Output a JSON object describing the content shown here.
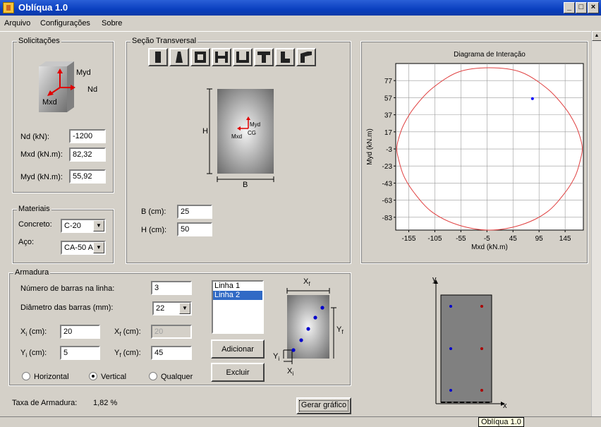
{
  "window": {
    "title": "Oblíqua 1.0"
  },
  "menu": [
    "Arquivo",
    "Configurações",
    "Sobre"
  ],
  "solicitacoes": {
    "title": "Solicitações",
    "icon_labels": {
      "myd": "Myd",
      "nd": "Nd",
      "mxd": "Mxd"
    },
    "nd_label": "Nd (kN):",
    "nd_value": "-1200",
    "mxd_label": "Mxd (kN.m):",
    "mxd_value": "82,32",
    "myd_label": "Myd (kN.m):",
    "myd_value": "55,92"
  },
  "materiais": {
    "title": "Materiais",
    "concreto_label": "Concreto:",
    "concreto_value": "C-20",
    "aco_label": "Aço:",
    "aco_value": "CA-50 A"
  },
  "secao": {
    "title": "Seção Transversal",
    "shape_icons": [
      "rect-shape-icon",
      "trapezoid-shape-icon",
      "hollow-box-shape-icon",
      "h-shape-icon",
      "u-shape-icon",
      "t-shape-icon",
      "l-shape-icon",
      "angled-shape-icon"
    ],
    "diagram_labels": {
      "h": "H",
      "b": "B",
      "myd": "Myd",
      "mxd": "Mxd",
      "cg": "CG"
    },
    "b_label": "B (cm):",
    "b_value": "25",
    "h_label": "H (cm):",
    "h_value": "50"
  },
  "chart_data": {
    "type": "line",
    "title": "Diagrama de Interação",
    "xlabel": "Mxd (kN.m)",
    "ylabel": "Myd (kN.m)",
    "x_ticks": [
      -155,
      -105,
      -55,
      -5,
      45,
      95,
      145
    ],
    "y_ticks": [
      77,
      57,
      37,
      17,
      -3,
      -23,
      -43,
      -63,
      -83
    ],
    "xlim": [
      -180,
      180
    ],
    "ylim": [
      -98,
      97
    ],
    "grid": true,
    "series": [
      {
        "type": "closed-curve",
        "color": "#e04040",
        "x": [
          0,
          60,
          110,
          145,
          165,
          175,
          178,
          175,
          165,
          145,
          110,
          60,
          0,
          -60,
          -110,
          -145,
          -165,
          -175,
          -178,
          -175,
          -165,
          -145,
          -110,
          -60
        ],
        "y": [
          92,
          87,
          68,
          45,
          25,
          8,
          -3,
          -14,
          -34,
          -54,
          -77,
          -92,
          -98,
          -92,
          -77,
          -54,
          -34,
          -14,
          -3,
          8,
          25,
          45,
          68,
          87
        ]
      },
      {
        "type": "point",
        "color": "#0000ff",
        "x": [
          82.32
        ],
        "y": [
          55.92
        ]
      }
    ]
  },
  "armadura": {
    "title": "Armadura",
    "num_barras_label": "Número de barras na linha:",
    "num_barras_value": "3",
    "diametro_label": "Diâmetro das barras (mm):",
    "diametro_value": "22",
    "xi_label": "X",
    "xi_sub": "i",
    "xi_unit": " (cm):",
    "xi_value": "20",
    "xf_label": "X",
    "xf_sub": "f",
    "xf_unit": " (cm):",
    "xf_value": "20",
    "yi_label": "Y",
    "yi_sub": "i",
    "yi_unit": " (cm):",
    "yi_value": "5",
    "yf_label": "Y",
    "yf_sub": "f",
    "yf_unit": " (cm):",
    "yf_value": "45",
    "radio_horizontal": "Horizontal",
    "radio_vertical": "Vertical",
    "radio_qualquer": "Qualquer",
    "selected": "Vertical",
    "lines": [
      "Linha 1",
      "Linha 2"
    ],
    "selected_line": "Linha 2",
    "add_button": "Adicionar",
    "delete_button": "Excluir",
    "diagram_labels": {
      "xf": "X",
      "xf_sub": "f",
      "yf": "Y",
      "yf_sub": "f",
      "yi": "Y",
      "yi_sub": "i",
      "xi": "X",
      "xi_sub": "i"
    }
  },
  "taxa": {
    "label": "Taxa de Armadura:",
    "value": "1,82 %"
  },
  "gerar_button": "Gerar gráfico",
  "section_preview": {
    "y_axis": "y",
    "x_axis": "x"
  },
  "tooltip": "Oblíqua 1.0"
}
